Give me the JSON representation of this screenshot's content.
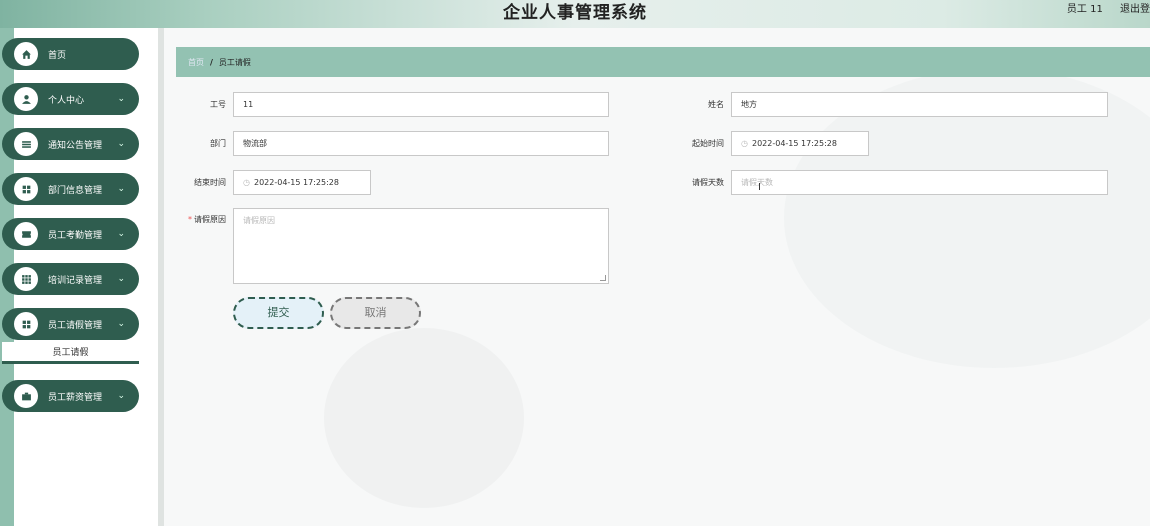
{
  "header": {
    "title": "企业人事管理系统",
    "user_label": "员工 11",
    "logout_label": "退出登"
  },
  "sidebar": {
    "items": [
      {
        "label": "首页",
        "icon": "home-icon",
        "has_chevron": false
      },
      {
        "label": "个人中心",
        "icon": "person-icon",
        "has_chevron": true
      },
      {
        "label": "通知公告管理",
        "icon": "list-icon",
        "has_chevron": true
      },
      {
        "label": "部门信息管理",
        "icon": "grid-icon",
        "has_chevron": true
      },
      {
        "label": "员工考勤管理",
        "icon": "ticket-icon",
        "has_chevron": true
      },
      {
        "label": "培训记录管理",
        "icon": "apps-icon",
        "has_chevron": true
      },
      {
        "label": "员工请假管理",
        "icon": "grid-icon",
        "has_chevron": true
      },
      {
        "label": "员工薪资管理",
        "icon": "briefcase-icon",
        "has_chevron": true
      }
    ],
    "sub_item": "员工请假",
    "chevron": "⌄"
  },
  "breadcrumb": {
    "home": "首页",
    "separator": "/",
    "current": "员工请假"
  },
  "form": {
    "employee_no_label": "工号",
    "employee_no_value": "11",
    "name_label": "姓名",
    "name_value": "地方",
    "department_label": "部门",
    "department_value": "物流部",
    "start_time_label": "起始时间",
    "start_time_value": "2022-04-15 17:25:28",
    "end_time_label": "结束时间",
    "end_time_value": "2022-04-15 17:25:28",
    "leave_days_label": "请假天数",
    "leave_days_placeholder": "请假天数",
    "reason_label": "请假原因",
    "reason_required": "*",
    "reason_placeholder": "请假原因",
    "submit_label": "提交",
    "cancel_label": "取消"
  },
  "colors": {
    "accent_dark": "#2f5d4f",
    "accent_light": "#93c2b2"
  }
}
